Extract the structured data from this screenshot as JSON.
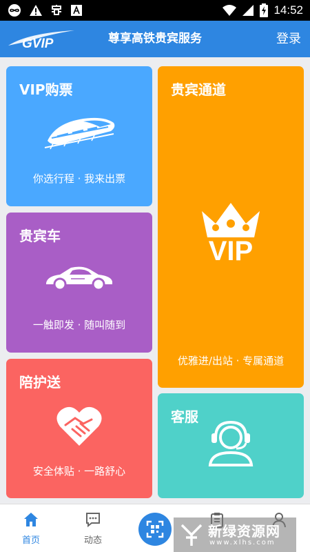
{
  "status_bar": {
    "time": "14:52",
    "left_icons": [
      "infinity-icon",
      "warning-icon",
      "bug-icon",
      "font-box-icon"
    ],
    "right_icons": [
      "wifi-icon",
      "signal-icon",
      "battery-charging-icon"
    ]
  },
  "header": {
    "title": "尊享高铁贵宾服务",
    "login_label": "登录",
    "logo_icon": "gvip-logo",
    "bg_color": "#2e86e1"
  },
  "tiles": {
    "vip_ticket": {
      "title": "VIP购票",
      "subtitle": "你选行程 · 我来出票",
      "icon": "high-speed-train-icon",
      "color": "#4aa8ff"
    },
    "vip_car": {
      "title": "贵宾车",
      "subtitle": "一触即发 · 随叫随到",
      "icon": "sports-car-icon",
      "color": "#a95ec6"
    },
    "escort": {
      "title": "陪护送",
      "subtitle": "安全体贴 · 一路舒心",
      "icon": "handshake-heart-icon",
      "color": "#fb6461"
    },
    "vip_channel": {
      "title": "贵宾通道",
      "badge": "VIP",
      "subtitle": "优雅进/出站 · 专属通道",
      "icon": "crown-icon",
      "color": "#ffa000"
    },
    "customer_service": {
      "title": "客服",
      "icon": "headset-agent-icon",
      "color": "#4fd1c9"
    }
  },
  "bottom_nav": {
    "items": [
      {
        "label": "首页",
        "icon": "home-icon",
        "active": true
      },
      {
        "label": "动态",
        "icon": "chat-icon",
        "active": false
      },
      {
        "label": "",
        "icon": "qr-scan-icon",
        "active": false
      },
      {
        "label": "",
        "icon": "clipboard-icon",
        "active": false
      },
      {
        "label": "",
        "icon": "person-icon",
        "active": false
      }
    ],
    "active_color": "#2e86e1",
    "inactive_color": "#666666"
  },
  "watermark": {
    "text": "新绿资源网",
    "url": "www.xlhs.com"
  }
}
